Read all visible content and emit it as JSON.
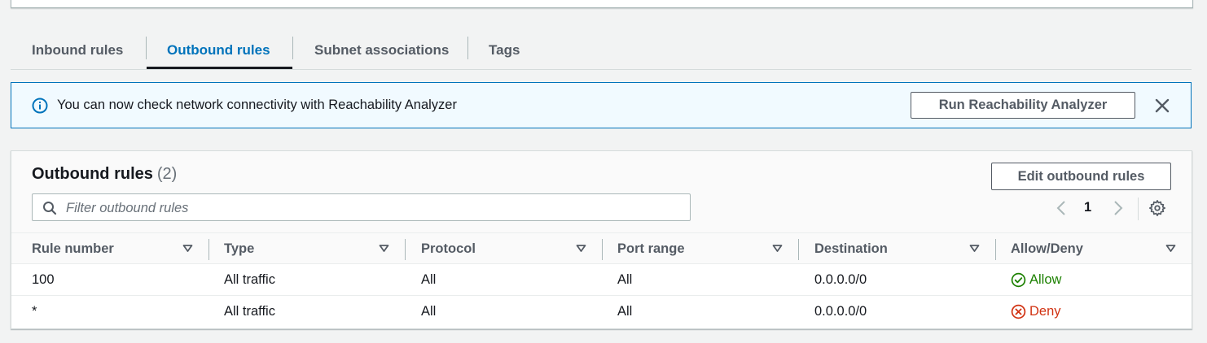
{
  "tabs": [
    {
      "label": "Inbound rules",
      "active": false
    },
    {
      "label": "Outbound rules",
      "active": true
    },
    {
      "label": "Subnet associations",
      "active": false
    },
    {
      "label": "Tags",
      "active": false
    }
  ],
  "flash": {
    "icon": "info-icon",
    "message": "You can now check network connectivity with Reachability Analyzer",
    "action_label": "Run Reachability Analyzer",
    "dismiss_icon": "close-icon"
  },
  "outbound": {
    "title": "Outbound rules",
    "count": "(2)",
    "edit_label": "Edit outbound rules",
    "filter_placeholder": "Filter outbound rules",
    "filter_value": "",
    "page": "1",
    "columns": [
      "Rule number",
      "Type",
      "Protocol",
      "Port range",
      "Destination",
      "Allow/Deny"
    ],
    "rows": [
      {
        "rule_number": "100",
        "type": "All traffic",
        "protocol": "All",
        "port_range": "All",
        "destination": "0.0.0.0/0",
        "action": "Allow"
      },
      {
        "rule_number": "*",
        "type": "All traffic",
        "protocol": "All",
        "port_range": "All",
        "destination": "0.0.0.0/0",
        "action": "Deny"
      }
    ]
  },
  "colors": {
    "accent": "#0073bb",
    "allow": "#1d8102",
    "deny": "#d13212",
    "background": "#f2f3f3"
  }
}
